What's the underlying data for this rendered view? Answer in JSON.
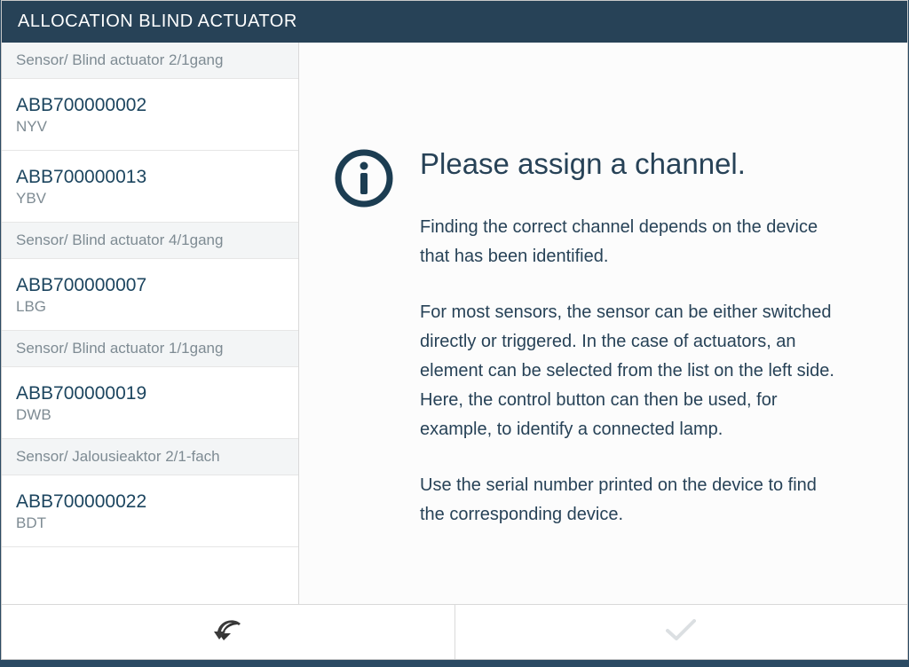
{
  "title": "ALLOCATION BLIND ACTUATOR",
  "sidebar": {
    "groups": [
      {
        "label": "Sensor/ Blind actuator 2/1gang",
        "devices": [
          {
            "id": "ABB700000002",
            "room": "NYV"
          },
          {
            "id": "ABB700000013",
            "room": "YBV"
          }
        ]
      },
      {
        "label": "Sensor/ Blind actuator 4/1gang",
        "devices": [
          {
            "id": "ABB700000007",
            "room": "LBG"
          }
        ]
      },
      {
        "label": "Sensor/ Blind actuator 1/1gang",
        "devices": [
          {
            "id": "ABB700000019",
            "room": "DWB"
          }
        ]
      },
      {
        "label": "Sensor/ Jalousieaktor 2/1-fach",
        "devices": [
          {
            "id": "ABB700000022",
            "room": "BDT"
          }
        ]
      }
    ]
  },
  "main": {
    "icon": "info-icon",
    "title": "Please assign a channel.",
    "para1": "Finding the correct channel depends on the device that has been identified.",
    "para2": "For most sensors, the sensor can be either switched directly or triggered. In the case of actuators, an element can be selected from the list on the left side. Here, the control button can then be used, for example, to identify a connected lamp.",
    "para3": "Use the serial number printed on the device to find the corresponding device."
  },
  "footer": {
    "back_icon": "back-arrow-icon",
    "confirm_icon": "checkmark-icon",
    "confirm_enabled": false
  },
  "colors": {
    "brand_dark": "#274257",
    "text_muted": "#7e8b93"
  }
}
